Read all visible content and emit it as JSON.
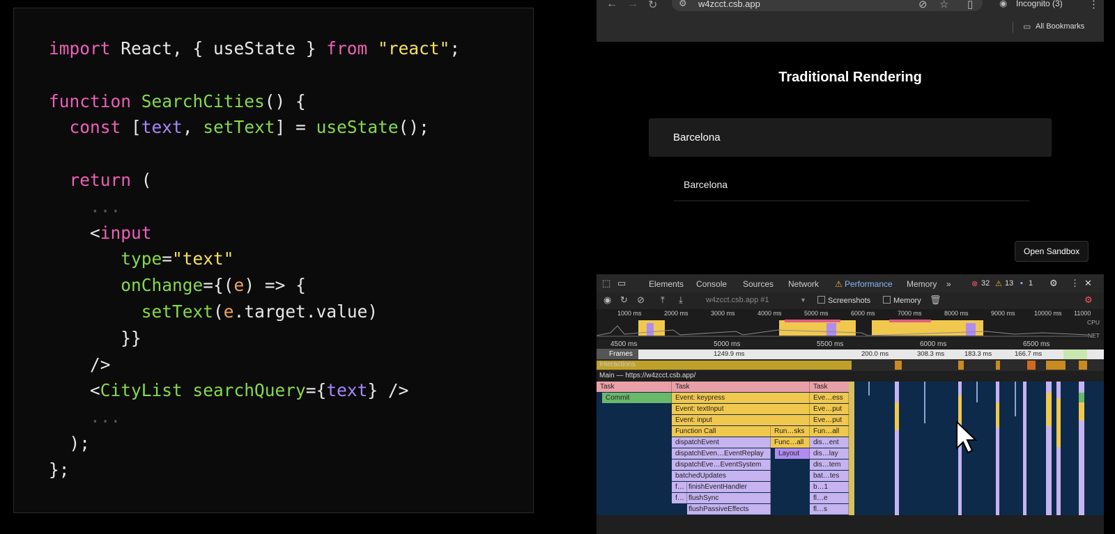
{
  "code": {
    "lines": [
      "import React, { useState } from \"react\";",
      "",
      "function SearchCities() {",
      "  const [text, setText] = useState();",
      "",
      "  return (",
      "    ...",
      "    <input",
      "       type=\"text\"",
      "       onChange={(e) => {",
      "         setText(e.target.value)",
      "       }}",
      "    />",
      "    <CityList searchQuery={text} />",
      "    ...",
      "  );",
      "};"
    ]
  },
  "browser": {
    "url": "w4zcct.csb.app",
    "incognito_label": "Incognito (3)",
    "bookmarks_label": "All Bookmarks"
  },
  "page": {
    "title": "Traditional Rendering",
    "search_value": "Barcelona",
    "city_item": "Barcelona",
    "open_sandbox": "Open Sandbox"
  },
  "devtools": {
    "tabs": [
      "Elements",
      "Console",
      "Sources",
      "Network",
      "Performance",
      "Memory"
    ],
    "more": "»",
    "errors": "32",
    "warnings": "13",
    "info": "1",
    "target": "w4zcct.csb.app #1",
    "screenshots_label": "Screenshots",
    "memory_label": "Memory",
    "overview_ticks": [
      "1000 ms",
      "2000 ms",
      "3000 ms",
      "4000 ms",
      "5000 ms",
      "6000 ms",
      "7000 ms",
      "8000 ms",
      "9000 ms",
      "10000 ms",
      "11000"
    ],
    "overview_labels": [
      "CPU",
      "NET"
    ],
    "ruler_ticks": [
      "4500 ms",
      "5000 ms",
      "5500 ms",
      "6000 ms",
      "6500 ms"
    ],
    "frames_label": "Frames",
    "frame_times": [
      "1249.9 ms",
      "200.0 ms",
      "308.3 ms",
      "183.3 ms",
      "166.7 ms"
    ],
    "interactions_label": "Interactions",
    "main_label": "Main — https://w4zcct.csb.app/",
    "flame": {
      "left_col": [
        "Task",
        "Commit"
      ],
      "main_col": [
        "Task",
        "Event: keypress",
        "Event: textInput",
        "Event: input",
        "Function Call",
        "dispatchEvent",
        "dispatchEven…EventReplay",
        "dispatchEve…EventSystem",
        "batchedUpdates",
        "finishEventHandler",
        "flushSync",
        "flushPassiveEffects"
      ],
      "mid_col": [
        "Run…sks",
        "Func…all",
        "Layout"
      ],
      "right_col": [
        "Task",
        "Eve…ess",
        "Eve…put",
        "Eve…put",
        "Fun…all",
        "dis…ent",
        "dis…lay",
        "dis…tem",
        "bat…tes",
        "b…1",
        "fl…e",
        "fl…s"
      ],
      "f_labels": [
        "f…",
        "f…"
      ]
    }
  }
}
